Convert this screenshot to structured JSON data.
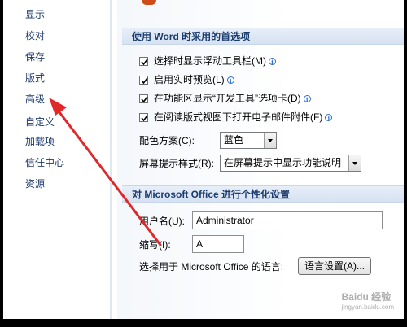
{
  "sidebar": {
    "items": [
      {
        "label": "显示"
      },
      {
        "label": "校对"
      },
      {
        "label": "保存"
      },
      {
        "label": "版式"
      },
      {
        "label": "高级"
      },
      {
        "label": "自定义"
      },
      {
        "label": "加载项"
      },
      {
        "label": "信任中心"
      },
      {
        "label": "资源"
      }
    ]
  },
  "word_options": {
    "header": "使用 Word 时采用的首选项",
    "checkboxes": [
      {
        "label": "选择时显示浮动工具栏(M)",
        "checked": true
      },
      {
        "label": "启用实时预览(L)",
        "checked": true
      },
      {
        "label": "在功能区显示“开发工具”选项卡(D)",
        "checked": true
      },
      {
        "label": "在阅读版式视图下打开电子邮件附件(F)",
        "checked": true
      }
    ],
    "color_scheme_label": "配色方案(C):",
    "color_scheme_value": "蓝色",
    "screentip_label": "屏幕提示样式(R):",
    "screentip_value": "在屏幕提示中显示功能说明"
  },
  "personalize": {
    "header": "对 Microsoft Office 进行个性化设置",
    "username_label": "用户名(U):",
    "username_value": "Administrator",
    "initials_label": "缩写(I):",
    "initials_value": "A",
    "language_label": "选择用于 Microsoft Office 的语言:",
    "language_button": "语言设置(A)..."
  },
  "watermark": {
    "text": "Baidu 经验",
    "sub": "jingyan.baidu.com"
  },
  "colors": {
    "annotation_arrow": "#e0282a"
  }
}
